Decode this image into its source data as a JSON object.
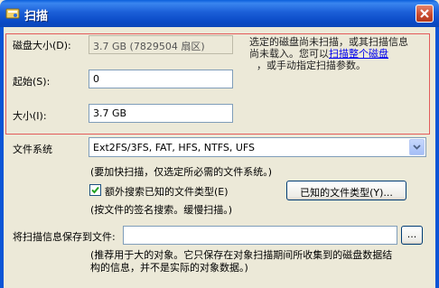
{
  "window": {
    "title": "扫描",
    "icon": "scan-icon"
  },
  "disk": {
    "size_label": "磁盘大小(D):",
    "size_value": "3.7 GB (7829504 扇区)",
    "start_label": "起始(S):",
    "start_value": "0",
    "length_label": "大小(I):",
    "length_value": "3.7 GB",
    "note_line1": "选定的磁盘尚未扫描，或其扫描信息",
    "note_line2_prefix": "尚未载入。您可以",
    "note_link": "扫描整个磁盘",
    "note_line3": "，或手动指定扫描参数。"
  },
  "filesystem": {
    "label": "文件系统",
    "selected": "Ext2FS/3FS, FAT, HFS, NTFS, UFS",
    "hint": "(要加快扫描，仅选定所必需的文件系统。)"
  },
  "extra_search": {
    "checked": true,
    "label": "额外搜索已知的文件类型(E)",
    "button_label": "已知的文件类型(Y)...",
    "hint": "(按文件的签名搜索。缓慢扫描。)"
  },
  "save_info": {
    "label": "将扫描信息保存到文件:",
    "value": "",
    "browse_label": "...",
    "hint_line1": "(推荐用于大的对象。它只保存在对象扫描期间所收集到的磁盘数据结",
    "hint_line2": "构的信息，并不是实际的对象数据。)"
  },
  "colors": {
    "title_bar": "#0b55d6",
    "dialog_bg": "#ece9d8",
    "highlight_border": "#e35b5b",
    "link": "#0000ee"
  }
}
